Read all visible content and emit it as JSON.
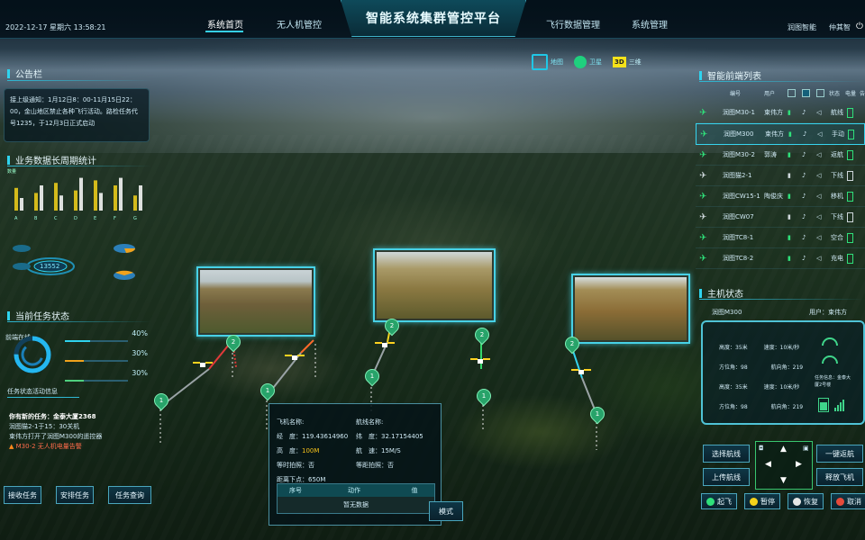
{
  "header": {
    "datetime": "2022-12-17 星期六 13:58:21",
    "title": "智能系统集群管控平台",
    "nav_left": [
      "系统首页",
      "无人机管控"
    ],
    "nav_right": [
      "飞行数据管理",
      "系统管理"
    ],
    "company": "润图智能",
    "user": "仲其智"
  },
  "map_modes": [
    {
      "icon": "map-icon",
      "label": "地图"
    },
    {
      "icon": "satellite-icon",
      "label": "卫星"
    },
    {
      "icon": "3d-icon",
      "label": "三维",
      "badge": "3D"
    }
  ],
  "notice": {
    "title": "公告栏",
    "text": "接上级通知：1月12日8：00-11月15日22：00，金山地区禁止各种飞行活动。路检任务代号1235，于12月3日正式启动"
  },
  "stats": {
    "title": "业务数据长周期统计",
    "y_label": "数量",
    "categories": [
      "A",
      "B",
      "C",
      "D",
      "E",
      "F",
      "G"
    ],
    "values_a": [
      18,
      14,
      22,
      16,
      24,
      20,
      12
    ],
    "values_b": [
      10,
      20,
      12,
      26,
      14,
      26,
      20
    ],
    "cylinder_label": "13552"
  },
  "task_status": {
    "title": "当前任务状态",
    "ring_label": "前端在线",
    "bars": [
      {
        "value": "40%"
      },
      {
        "value": "30%"
      },
      {
        "value": "30%"
      }
    ],
    "activity_title": "任务状态活动信息",
    "new_task": "你有新的任务：金泰大厦2368",
    "lines": [
      "润图猫2-1于15：30关机",
      "束伟方打开了润图M300的遥控器"
    ],
    "warning": "M30-2 无人机电量告警",
    "buttons": [
      "接收任务",
      "安排任务",
      "任务查询"
    ]
  },
  "info_popup": {
    "left": [
      {
        "label": "飞机名称:",
        "value": ""
      },
      {
        "label": "经　度：",
        "value": "119.43614960"
      },
      {
        "label": "高　度：",
        "value": "100M"
      },
      {
        "label": "等时拍照：",
        "value": "否"
      },
      {
        "label": "距离下点：",
        "value": "650M"
      }
    ],
    "right": [
      {
        "label": "航线名称:",
        "value": ""
      },
      {
        "label": "纬　度：",
        "value": "32.17154405"
      },
      {
        "label": "航　速：",
        "value": "15M/S"
      },
      {
        "label": "等距拍照：",
        "value": "否"
      }
    ],
    "table_headers": [
      "序号",
      "动作",
      "值"
    ],
    "table_empty": "暂无数据",
    "mode_button": "模式"
  },
  "pins": [
    "1",
    "2",
    "1",
    "2",
    "1",
    "2",
    "1",
    "1",
    "1",
    "2",
    "1"
  ],
  "device_list": {
    "title": "智能前端列表",
    "headers": [
      "编号",
      "用户",
      "状态",
      "电量",
      "告"
    ],
    "rows": [
      {
        "icon": "drone-icon",
        "name": "润图M30-1",
        "user": "束伟方",
        "status": "航线",
        "color": "#2fe07a"
      },
      {
        "icon": "drone-icon",
        "name": "润图M300",
        "user": "束伟方",
        "status": "手动",
        "color": "#2fe07a",
        "selected": true
      },
      {
        "icon": "drone-icon",
        "name": "润图M30-2",
        "user": "郭涛",
        "status": "返航",
        "color": "#2fe07a"
      },
      {
        "icon": "drone-icon",
        "name": "润图猫2-1",
        "user": "",
        "status": "下线",
        "color": "#cfd8dc"
      },
      {
        "icon": "plane-icon",
        "name": "润图CW15-1",
        "user": "陶俊庆",
        "status": "移机",
        "color": "#2fe07a"
      },
      {
        "icon": "plane-icon",
        "name": "润图CW07",
        "user": "",
        "status": "下线",
        "color": "#cfd8dc"
      },
      {
        "icon": "station-icon",
        "name": "润图TC8-1",
        "user": "",
        "status": "空合",
        "color": "#2fe07a"
      },
      {
        "icon": "station-icon",
        "name": "润图TC8-2",
        "user": "",
        "status": "充电",
        "color": "#2fe07a"
      }
    ]
  },
  "host_status": {
    "title": "主机状态",
    "device": "润图M300",
    "user_label": "用户：束伟方",
    "rows": [
      [
        "高度：35米",
        "速度：10米/秒"
      ],
      [
        "方位角：98",
        "航向角：219"
      ],
      [
        "高度：35米",
        "速度：10米/秒"
      ],
      [
        "方位角：98",
        "航向角：219"
      ]
    ],
    "task_info": "任务信息：金泰大厦2号楼",
    "buttons_left": [
      "选择航线",
      "上传航线"
    ],
    "buttons_right": [
      "一键返航",
      "释放飞机"
    ],
    "actions": [
      "起飞",
      "暂停",
      "恢复",
      "取消"
    ]
  }
}
